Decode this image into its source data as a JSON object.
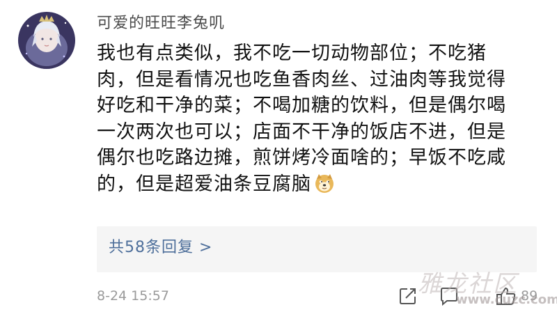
{
  "user": {
    "name": "可爱的旺旺李兔叽"
  },
  "comment": {
    "lines": [
      "我也有点类似，我不吃一切动物部位；不吃猪",
      "肉，但是看情况也吃鱼香肉丝、过油肉等我觉得",
      "好吃和干净的菜；不喝加糖的饮料，但是偶尔喝",
      "一次两次也可以；店面不干净的饭店不进，但是",
      "偶尔也吃路边摊，煎饼烤冷面啥的；早饭不吃咸",
      "的，但是超爱油条豆腐脑"
    ],
    "emoji": "doge-emoji"
  },
  "replies": {
    "label": "共58条回复 >"
  },
  "meta": {
    "timestamp": "8-24 15:57",
    "like_count": "89"
  },
  "icons": {
    "share": "share-icon",
    "comment": "comment-icon",
    "like": "like-icon"
  },
  "watermark": {
    "text": "雅龙社区",
    "url": "www.cuzc.com"
  },
  "colors": {
    "link": "#4d6e9a",
    "meta": "#9a9a9a",
    "reply_bg": "#f5f5f5"
  }
}
